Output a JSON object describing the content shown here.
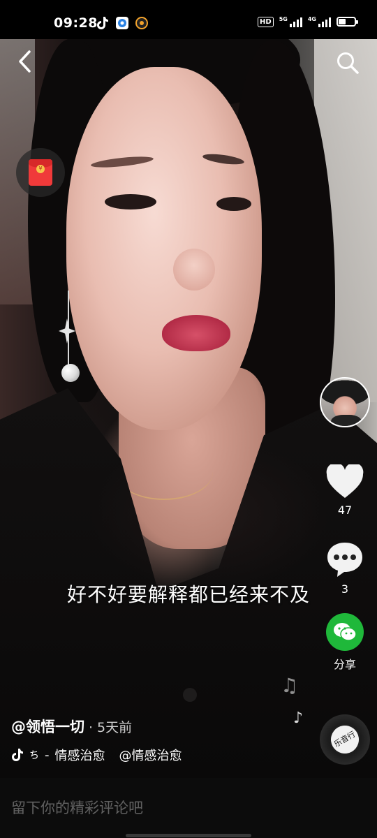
{
  "status_bar": {
    "time": "09:28",
    "app_icons": [
      "tiktok-icon",
      "blue-circle-app-icon",
      "orange-circle-app-icon"
    ],
    "hd_label": "HD",
    "signal_1_label": "5G",
    "signal_2_label": "4G",
    "battery_level": 0.45
  },
  "video": {
    "subtitle": "好不好要解释都已经来不及"
  },
  "rail": {
    "like_count": "47",
    "comment_count": "3",
    "share_label": "分享"
  },
  "disc": {
    "label": "乐音行"
  },
  "post": {
    "author": "@领悟一切",
    "time_sep": "·",
    "posted": "5天前",
    "tag_prefix": "ち",
    "tag_sep": "-",
    "tag_1": "情感治愈",
    "tag_2": "@情感治愈"
  },
  "comment": {
    "placeholder": "留下你的精彩评论吧"
  },
  "colors": {
    "share_green": "#1fb83a",
    "redpacket_red": "#f03a3a"
  }
}
